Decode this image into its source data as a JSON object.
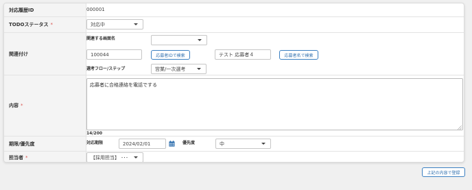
{
  "rows": {
    "history_id": {
      "label": "対応履歴ID",
      "value": "000001"
    },
    "todo_status": {
      "label": "TODOステータス",
      "required": "*",
      "value": "対応中"
    },
    "related": {
      "label": "関連付け",
      "screen_name_label": "関連する画面名",
      "screen_name_value": "",
      "applicant_id_value": "100044",
      "search_by_id_button": "応募者IDで検索",
      "applicant_name_value": "テスト 応募者４",
      "search_by_name_button": "応募者名で検索",
      "flow_step_label": "選考フロー/ステップ",
      "flow_step_value": "営業/一次選考"
    },
    "content": {
      "label": "内容",
      "required": "*",
      "value": "応募者に合格連絡を電話でする",
      "char_count": "14/200"
    },
    "deadline": {
      "label": "期限/優先度",
      "deadline_label": "対応期限",
      "deadline_value": "2024/02/01",
      "priority_label": "優先度",
      "priority_value": "中"
    },
    "assignee": {
      "label": "担当者",
      "required": "*",
      "value": "【採用担当】 ･･･"
    }
  },
  "submit_button": "上記の内容で登録",
  "colors": {
    "accent": "#2f6fae",
    "required": "#d9534f",
    "label_bg": "#f4f4f4"
  },
  "icons": {
    "calendar": "calendar-icon",
    "dropdown": "chevron-down-icon"
  }
}
